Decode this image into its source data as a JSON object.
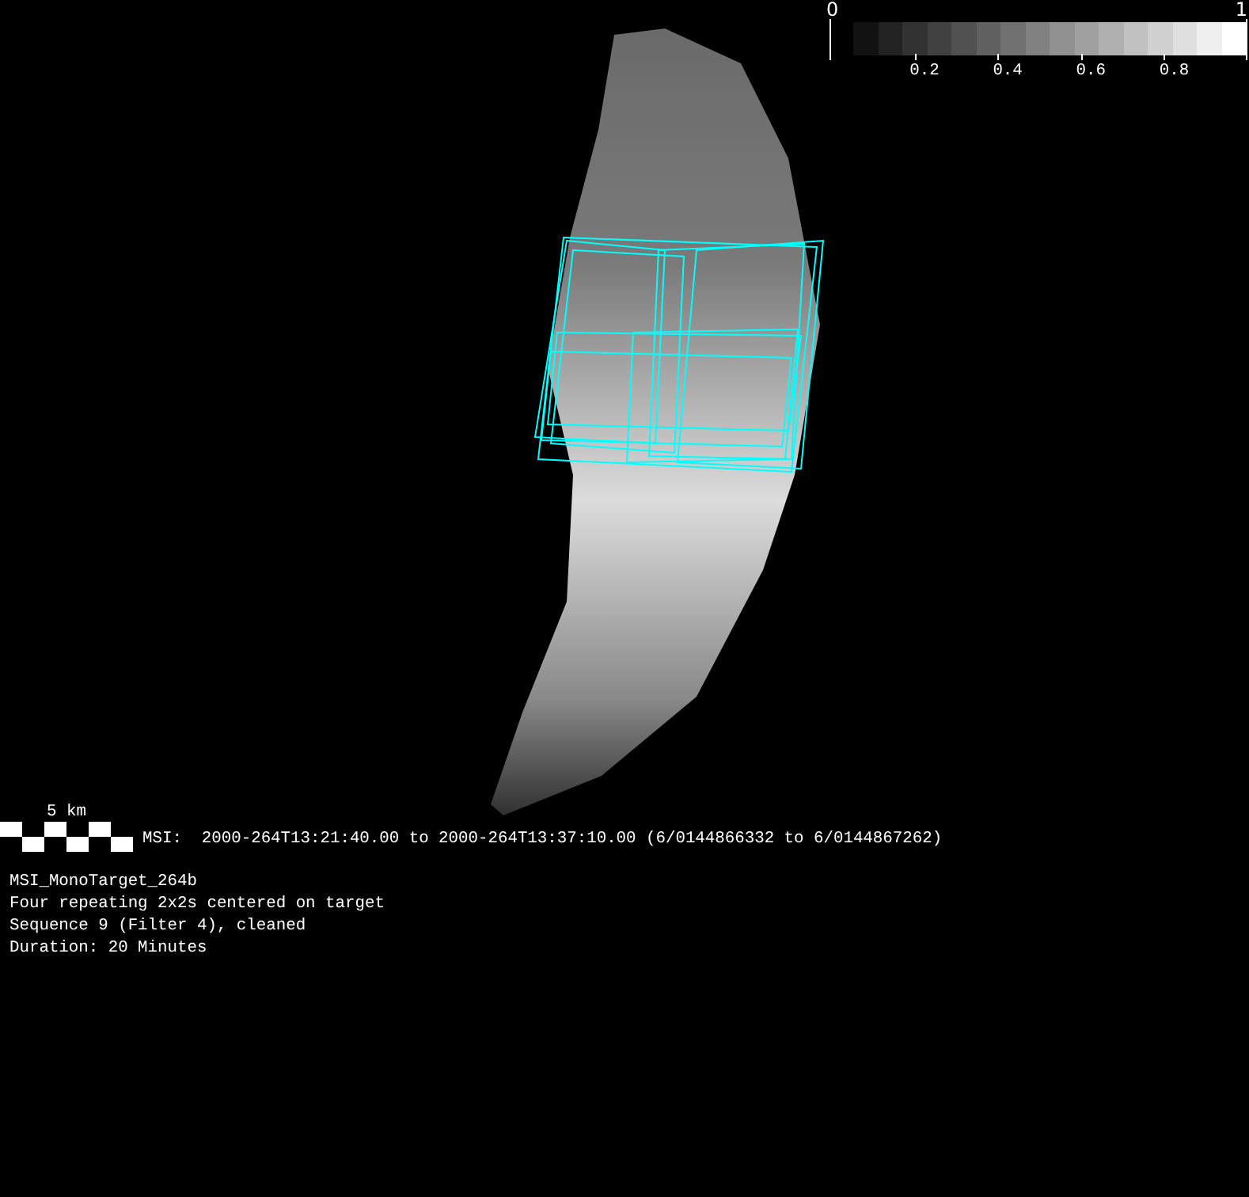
{
  "colorbar": {
    "min_label": "0",
    "max_label": "1",
    "tick_labels": [
      "0.2",
      "0.4",
      "0.6",
      "0.8"
    ]
  },
  "scale_bar": {
    "label": "5 km"
  },
  "time_range": "MSI:  2000-264T13:21:40.00 to 2000-264T13:37:10.00 (6/0144866332 to 6/0144867262)",
  "info_lines": [
    "MSI_MonoTarget_264b",
    "Four repeating 2x2s centered on target",
    "Sequence 9 (Filter 4), cleaned",
    "Duration: 20 Minutes"
  ]
}
